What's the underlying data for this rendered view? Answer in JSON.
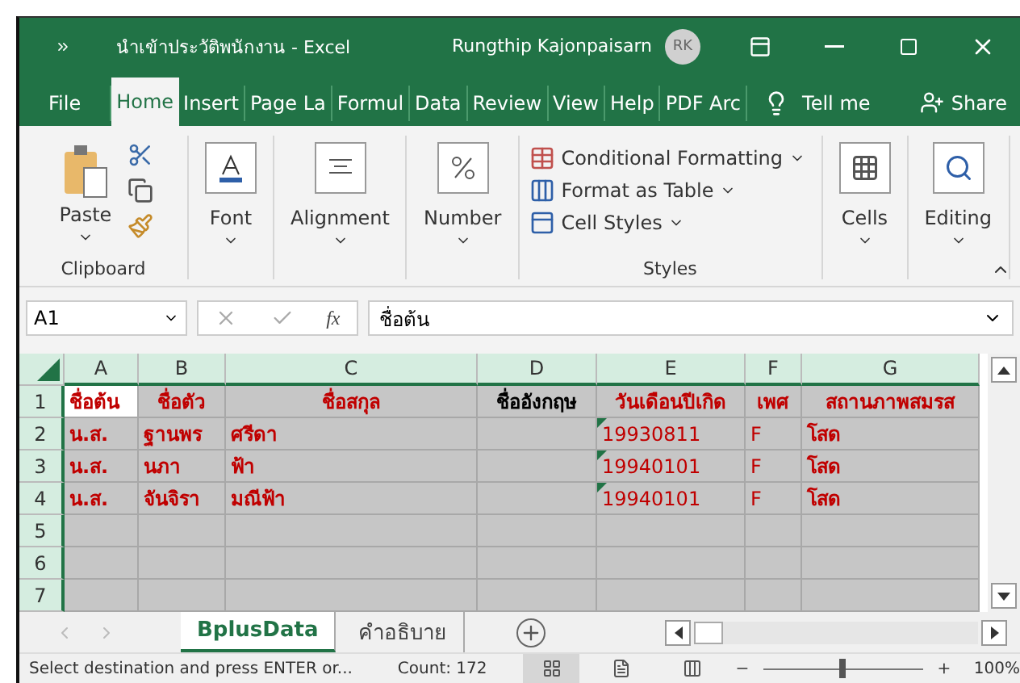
{
  "window": {
    "title": "นำเข้าประวัติพนักงาน  -  Excel",
    "user": "Rungthip Kajonpaisarn",
    "avatar": "RK"
  },
  "ribbon_tabs": [
    {
      "label": "File",
      "selected": false
    },
    {
      "label": "Home",
      "selected": true
    },
    {
      "label": "Insert",
      "selected": false
    },
    {
      "label": "Page La",
      "selected": false
    },
    {
      "label": "Formul",
      "selected": false
    },
    {
      "label": "Data",
      "selected": false
    },
    {
      "label": "Review",
      "selected": false
    },
    {
      "label": "View",
      "selected": false
    },
    {
      "label": "Help",
      "selected": false
    },
    {
      "label": "PDF Arc",
      "selected": false
    }
  ],
  "tell_me": "Tell me",
  "share": "Share",
  "ribbon": {
    "clipboard": {
      "paste": "Paste",
      "label": "Clipboard"
    },
    "groups": [
      {
        "kind": "font",
        "label": "Font"
      },
      {
        "kind": "alignment",
        "label": "Alignment"
      },
      {
        "kind": "number",
        "label": "Number"
      }
    ],
    "styles": {
      "items": [
        {
          "kind": "conditional",
          "label": "Conditional Formatting"
        },
        {
          "kind": "table",
          "label": "Format as Table"
        },
        {
          "kind": "cellstyles",
          "label": "Cell Styles"
        }
      ],
      "label": "Styles"
    },
    "right_groups": [
      {
        "kind": "cells",
        "label": "Cells"
      },
      {
        "kind": "editing",
        "label": "Editing"
      }
    ]
  },
  "formula_bar": {
    "name_box": "A1",
    "function_label": "fx",
    "value": "ชื่อต้น"
  },
  "columns": [
    "A",
    "B",
    "C",
    "D",
    "E",
    "F",
    "G"
  ],
  "rows": [
    {
      "label": "1",
      "cells": [
        {
          "text": "ชื่อต้น",
          "color": "#c00000",
          "bold": true,
          "active": true
        },
        {
          "text": "ชื่อตัว",
          "color": "#c00000",
          "bold": true
        },
        {
          "text": "ชื่อสกุล",
          "color": "#c00000",
          "bold": true
        },
        {
          "text": "ชื่ออังกฤษ",
          "color": "#000000",
          "bold": true
        },
        {
          "text": "วันเดือนปีเกิด",
          "color": "#c00000",
          "bold": true
        },
        {
          "text": "เพศ",
          "color": "#c00000",
          "bold": true
        },
        {
          "text": "สถานภาพสมรส",
          "color": "#c00000",
          "bold": true
        }
      ]
    },
    {
      "label": "2",
      "cells": [
        {
          "text": "น.ส.",
          "color": "#c00000",
          "bold": true
        },
        {
          "text": "ฐานพร",
          "color": "#c00000",
          "bold": true
        },
        {
          "text": "ศรีดา",
          "color": "#c00000",
          "bold": true
        },
        null,
        {
          "text": "19930811",
          "color": "#c00000",
          "bold": false,
          "flagged": true
        },
        {
          "text": "F",
          "color": "#c00000",
          "bold": false
        },
        {
          "text": "โสด",
          "color": "#c00000",
          "bold": true
        }
      ]
    },
    {
      "label": "3",
      "cells": [
        {
          "text": "น.ส.",
          "color": "#c00000",
          "bold": true
        },
        {
          "text": "นภา",
          "color": "#c00000",
          "bold": true
        },
        {
          "text": "ฟ้า",
          "color": "#c00000",
          "bold": true
        },
        null,
        {
          "text": "19940101",
          "color": "#c00000",
          "bold": false,
          "flagged": true
        },
        {
          "text": "F",
          "color": "#c00000",
          "bold": false
        },
        {
          "text": "โสด",
          "color": "#c00000",
          "bold": true
        }
      ]
    },
    {
      "label": "4",
      "cells": [
        {
          "text": "น.ส.",
          "color": "#c00000",
          "bold": true
        },
        {
          "text": "จันจิรา",
          "color": "#c00000",
          "bold": true
        },
        {
          "text": "มณีฟ้า",
          "color": "#c00000",
          "bold": true
        },
        null,
        {
          "text": "19940101",
          "color": "#c00000",
          "bold": false,
          "flagged": true
        },
        {
          "text": "F",
          "color": "#c00000",
          "bold": false
        },
        {
          "text": "โสด",
          "color": "#c00000",
          "bold": true
        }
      ]
    },
    {
      "label": "5"
    },
    {
      "label": "6"
    },
    {
      "label": "7"
    }
  ],
  "sheet_tabs": [
    {
      "label": "BplusData",
      "selected": true
    },
    {
      "label": "คำอธิบาย",
      "selected": false
    }
  ],
  "status_bar": {
    "message": "Select destination and press ENTER or...",
    "count": "Count: 172",
    "zoom": {
      "level": 0.5,
      "reading": "100%"
    }
  }
}
